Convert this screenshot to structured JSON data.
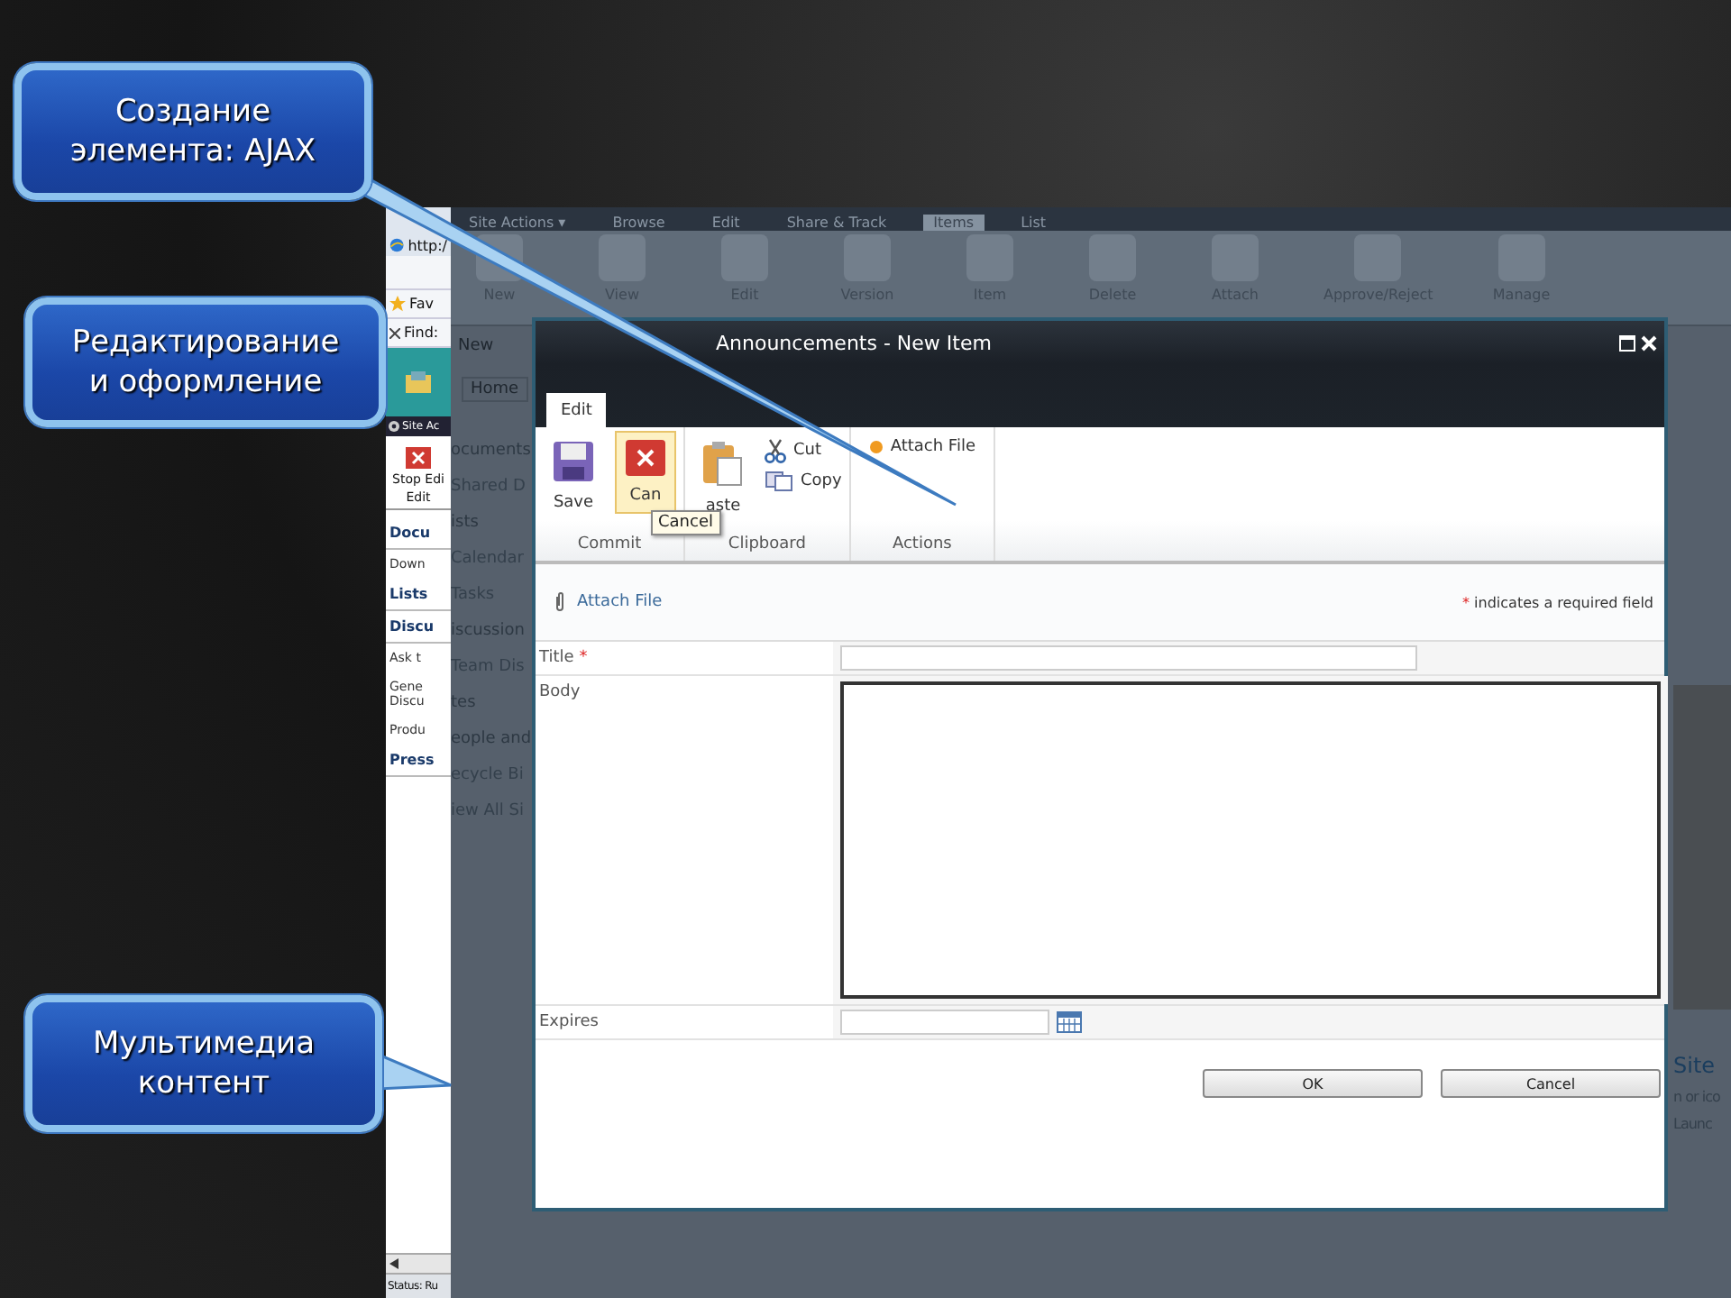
{
  "callouts": [
    {
      "text": "Создание\nэлемента: AJAX"
    },
    {
      "text": "Редактирование\nи оформление"
    },
    {
      "text": "Мультимедиа\nконтент"
    }
  ],
  "browser": {
    "address": "http:/",
    "favorites": "Fav",
    "find": "Find:",
    "site_actions": "Site Ac",
    "stop_editing": "Stop Edi",
    "stop_group": "Edit",
    "nav": [
      {
        "text": "Docu",
        "kind": "heading"
      },
      {
        "text": "Down",
        "kind": "link"
      },
      {
        "text": "Lists",
        "kind": "heading"
      },
      {
        "text": "Discu",
        "kind": "heading"
      },
      {
        "text": "Ask t",
        "kind": "link"
      },
      {
        "text": "Gene\nDiscu",
        "kind": "link"
      },
      {
        "text": "Produ",
        "kind": "link"
      },
      {
        "text": "Press",
        "kind": "heading"
      }
    ],
    "status": "Status: Ru"
  },
  "site": {
    "ribbon_tabs": [
      {
        "label": "Site Actions ▾",
        "selected": false
      },
      {
        "label": "Browse",
        "selected": false
      },
      {
        "label": "Edit",
        "selected": false
      },
      {
        "label": "Share & Track",
        "selected": false
      },
      {
        "label": "Items",
        "selected": true
      },
      {
        "label": "List",
        "selected": false
      }
    ],
    "ribbon_buttons": [
      "New",
      "View",
      "Edit",
      "Version",
      "Item",
      "Delete",
      "Attach",
      "Approve/Reject",
      "Manage"
    ],
    "ribbon_group": "New",
    "home_tab": "Home",
    "nav": [
      {
        "text": "ocuments",
        "kind": "heading"
      },
      {
        "text": "Shared D",
        "kind": "link"
      },
      {
        "text": "ists",
        "kind": "heading"
      },
      {
        "text": "Calendar",
        "kind": "link"
      },
      {
        "text": "Tasks",
        "kind": "link"
      },
      {
        "text": "iscussion",
        "kind": "heading"
      },
      {
        "text": "Team Dis",
        "kind": "link"
      },
      {
        "text": "tes",
        "kind": "heading"
      },
      {
        "text": "eople and",
        "kind": "heading"
      },
      {
        "text": "ecycle Bi",
        "kind": "link"
      },
      {
        "text": "iew All Si",
        "kind": "link"
      }
    ],
    "right_texts": [
      "Site",
      "n or ico",
      "Launc"
    ]
  },
  "dialog": {
    "title": "Announcements - New Item",
    "tabs": [
      {
        "label": "Edit",
        "selected": true
      }
    ],
    "groups": [
      {
        "label": "Commit",
        "buttons": [
          {
            "label": "Save",
            "kind": "save",
            "selected": false
          },
          {
            "label": "Can",
            "kind": "cancel",
            "selected": true
          }
        ]
      },
      {
        "label": "Clipboard",
        "buttons": [
          {
            "label": "aste",
            "kind": "paste",
            "selected": false
          },
          {
            "label": "Cut",
            "kind": "cut",
            "selected": false
          },
          {
            "label": "Copy",
            "kind": "copy",
            "selected": false
          }
        ]
      },
      {
        "label": "Actions",
        "buttons": [
          {
            "label": "Attach File",
            "kind": "attach",
            "selected": false
          }
        ]
      }
    ],
    "tooltip": "Cancel",
    "attach_link": "Attach File",
    "required_mark": "*",
    "required_note": "indicates a required field",
    "fields": [
      {
        "label": "Title",
        "required_mark": "*",
        "kind": "text"
      },
      {
        "label": "Body",
        "kind": "textarea"
      },
      {
        "label": "Expires",
        "kind": "date"
      }
    ],
    "buttons": [
      "OK",
      "Cancel"
    ]
  }
}
